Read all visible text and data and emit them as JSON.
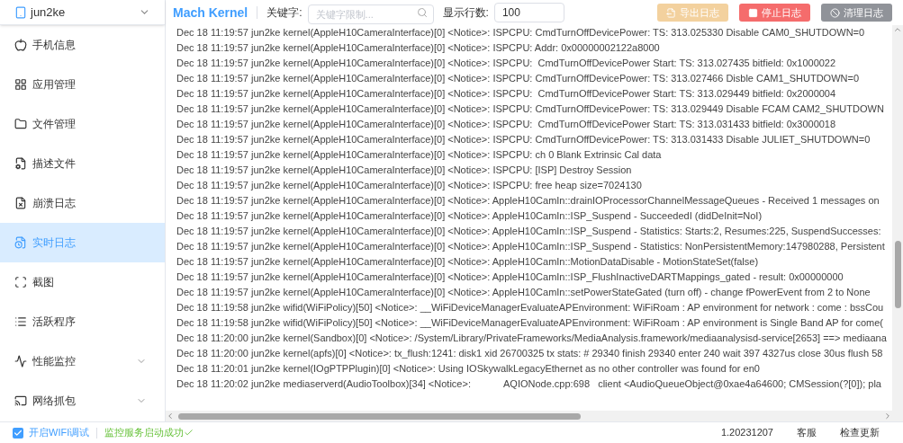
{
  "device": {
    "name": "jun2ke"
  },
  "sidebar": {
    "items": [
      {
        "label": "手机信息",
        "selected": false,
        "expandable": false
      },
      {
        "label": "应用管理",
        "selected": false,
        "expandable": false
      },
      {
        "label": "文件管理",
        "selected": false,
        "expandable": false
      },
      {
        "label": "描述文件",
        "selected": false,
        "expandable": false
      },
      {
        "label": "崩溃日志",
        "selected": false,
        "expandable": false
      },
      {
        "label": "实时日志",
        "selected": true,
        "expandable": false
      },
      {
        "label": "截图",
        "selected": false,
        "expandable": false
      },
      {
        "label": "活跃程序",
        "selected": false,
        "expandable": false
      },
      {
        "label": "性能监控",
        "selected": false,
        "expandable": true
      },
      {
        "label": "网络抓包",
        "selected": false,
        "expandable": true
      }
    ]
  },
  "header": {
    "title": "Mach Kernel",
    "keyword": {
      "label": "关键字:",
      "placeholder": "关键字限制..."
    },
    "rows": {
      "label": "显示行数:",
      "value": "100"
    },
    "buttons": [
      {
        "label": "导出日志",
        "kind": "export",
        "disabled": true
      },
      {
        "label": "停止日志",
        "kind": "stop",
        "disabled": false
      },
      {
        "label": "清理日志",
        "kind": "clear",
        "disabled": false
      }
    ]
  },
  "log": {
    "lines": [
      "Dec 18 11:19:57 jun2ke kernel(AppleH10CameraInterface)[0] <Notice>: ISPCPU: CmdTurnOffDevicePower: TS: 313.025330 Disable CAM0_SHUTDOWN=0",
      "Dec 18 11:19:57 jun2ke kernel(AppleH10CameraInterface)[0] <Notice>: ISPCPU: Addr: 0x00000002122a8000",
      "Dec 18 11:19:57 jun2ke kernel(AppleH10CameraInterface)[0] <Notice>: ISPCPU:  CmdTurnOffDevicePower Start: TS: 313.027435 bitfield: 0x1000022",
      "Dec 18 11:19:57 jun2ke kernel(AppleH10CameraInterface)[0] <Notice>: ISPCPU: CmdTurnOffDevicePower: TS: 313.027466 Disble CAM1_SHUTDOWN=0",
      "Dec 18 11:19:57 jun2ke kernel(AppleH10CameraInterface)[0] <Notice>: ISPCPU:  CmdTurnOffDevicePower Start: TS: 313.029449 bitfield: 0x2000004",
      "Dec 18 11:19:57 jun2ke kernel(AppleH10CameraInterface)[0] <Notice>: ISPCPU: CmdTurnOffDevicePower: TS: 313.029449 Disable FCAM CAM2_SHUTDOWN",
      "Dec 18 11:19:57 jun2ke kernel(AppleH10CameraInterface)[0] <Notice>: ISPCPU:  CmdTurnOffDevicePower Start: TS: 313.031433 bitfield: 0x3000018",
      "Dec 18 11:19:57 jun2ke kernel(AppleH10CameraInterface)[0] <Notice>: ISPCPU: CmdTurnOffDevicePower: TS: 313.031433 Disable JULIET_SHUTDOWN=0",
      "Dec 18 11:19:57 jun2ke kernel(AppleH10CameraInterface)[0] <Notice>: ISPCPU: ch 0 Blank Extrinsic Cal data",
      "Dec 18 11:19:57 jun2ke kernel(AppleH10CameraInterface)[0] <Notice>: ISPCPU: [ISP] Destroy Session",
      "Dec 18 11:19:57 jun2ke kernel(AppleH10CameraInterface)[0] <Notice>: ISPCPU: free heap size=7024130",
      "Dec 18 11:19:57 jun2ke kernel(AppleH10CameraInterface)[0] <Notice>: AppleH10CamIn::drainIOProcessorChannelMessageQueues - Received 1 messages on",
      "Dec 18 11:19:57 jun2ke kernel(AppleH10CameraInterface)[0] <Notice>: AppleH10CamIn::ISP_Suspend - SucceededI (didDeInit=NoI)",
      "Dec 18 11:19:57 jun2ke kernel(AppleH10CameraInterface)[0] <Notice>: AppleH10CamIn::ISP_Suspend - Statistics: Starts:2, Resumes:225, SuspendSuccesses:",
      "Dec 18 11:19:57 jun2ke kernel(AppleH10CameraInterface)[0] <Notice>: AppleH10CamIn::ISP_Suspend - Statistics: NonPersistentMemory:147980288, Persistent",
      "Dec 18 11:19:57 jun2ke kernel(AppleH10CameraInterface)[0] <Notice>: AppleH10CamIn::MotionDataDisable - MotionStateSet(false)",
      "Dec 18 11:19:57 jun2ke kernel(AppleH10CameraInterface)[0] <Notice>: AppleH10CamIn::ISP_FlushInactiveDARTMappings_gated - result: 0x00000000",
      "Dec 18 11:19:57 jun2ke kernel(AppleH10CameraInterface)[0] <Notice>: AppleH10CamIn::setPowerStateGated (turn off) - change fPowerEvent from 2 to None",
      "Dec 18 11:19:58 jun2ke wifid(WiFiPolicy)[50] <Notice>: __WiFiDeviceManagerEvaluateAPEnvironment: WiFiRoam : AP environment for network : come : bssCou",
      "Dec 18 11:19:58 jun2ke wifid(WiFiPolicy)[50] <Notice>: __WiFiDeviceManagerEvaluateAPEnvironment: WiFiRoam : AP environment is Single Band AP for come(",
      "Dec 18 11:20:00 jun2ke kernel(Sandbox)[0] <Notice>: /System/Library/PrivateFrameworks/MediaAnalysis.framework/mediaanalysisd-service[2653] ==> mediaana",
      "Dec 18 11:20:00 jun2ke kernel(apfs)[0] <Notice>: tx_flush:1241: disk1 xid 26700325 tx stats: # 29340 finish 29340 enter 240 wait 397 4327us close 30us flush 58",
      "Dec 18 11:20:01 jun2ke kernel(IOgPTPPlugin)[0] <Notice>: Using IOSkywalkLegacyEthernet as no other controller was found for en0",
      "Dec 18 11:20:02 jun2ke mediaserverd(AudioToolbox)[34] <Notice>:            AQIONode.cpp:698   client <AudioQueueObject@0xae4a64600; CMSession(?[0]); pla"
    ]
  },
  "footer": {
    "wifi_debug": {
      "label": "开启WIFI调试",
      "checked": true
    },
    "status": "监控服务启动成功",
    "version": "1.20231207",
    "links": [
      "客服",
      "检查更新"
    ]
  }
}
